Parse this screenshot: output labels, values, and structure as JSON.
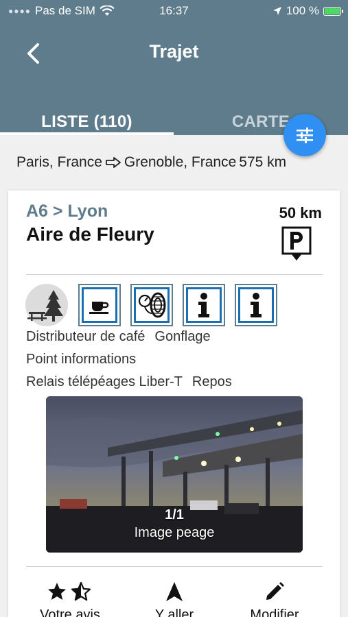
{
  "status_bar": {
    "carrier": "Pas de SIM",
    "time": "16:37",
    "battery": "100 %"
  },
  "header": {
    "title": "Trajet",
    "back_icon": "chevron-left-icon"
  },
  "tabs": [
    {
      "label": "LISTE (110)",
      "active": true
    },
    {
      "label": "CARTE",
      "active": false
    }
  ],
  "filter_button": {
    "icon": "sliders-icon"
  },
  "route": {
    "from": "Paris, France",
    "to": "Grenoble, France",
    "distance": "575 km"
  },
  "rest_area": {
    "road": "A6 > Lyon",
    "name": "Aire de Fleury",
    "distance": "50 km",
    "parking_icon": "parking-icon",
    "service_icons": [
      "picnic-tree-icon",
      "coffee-icon",
      "tire-pressure-icon",
      "information-icon",
      "information-icon"
    ],
    "services_line1": [
      "Distributeur de café",
      "Gonflage"
    ],
    "services_line2": [
      "Point informations"
    ],
    "services_line3": [
      "Relais télépéages Liber-T",
      "Repos"
    ],
    "photo": {
      "counter": "1/1",
      "caption": "Image peage"
    },
    "actions": [
      {
        "label": "Votre avis",
        "icon": "star-rating-icon"
      },
      {
        "label": "Y aller",
        "icon": "navigation-arrow-icon"
      },
      {
        "label": "Modifier",
        "icon": "pencil-icon"
      }
    ]
  },
  "colors": {
    "header": "#5e7c8b",
    "fab": "#2f8ff2",
    "icon_border": "#1a6fb0"
  }
}
